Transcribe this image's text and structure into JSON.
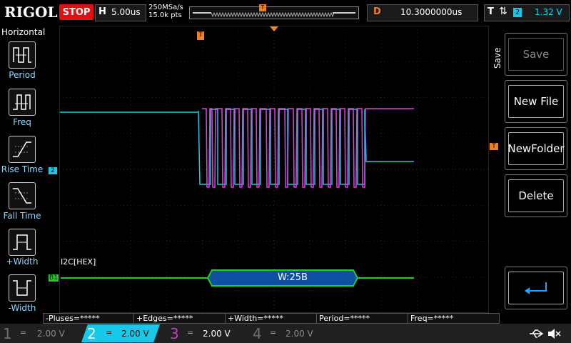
{
  "top_bar": {
    "logo": "RIGOL",
    "run_state": "STOP",
    "horizontal": {
      "label": "H",
      "value": "5.00us"
    },
    "sample_rate": "250MSa/s",
    "points": "15.0k pts",
    "trigger_position_marker": "T",
    "delay": {
      "label": "D",
      "value": "10.3000000us"
    },
    "trigger": {
      "label": "T",
      "edge": "⇅",
      "source": "2",
      "level": "1.32 V"
    }
  },
  "left_menu": {
    "title": "Horizontal",
    "items": [
      {
        "label": "Period",
        "icon": "period-icon"
      },
      {
        "label": "Freq",
        "icon": "frequency-icon"
      },
      {
        "label": "Rise Time",
        "icon": "rise-time-icon"
      },
      {
        "label": "Fall Time",
        "icon": "fall-time-icon"
      },
      {
        "label": "+Width",
        "icon": "positive-width-icon"
      },
      {
        "label": "-Width",
        "icon": "negative-width-icon"
      }
    ]
  },
  "right_menu": {
    "tab": "Save",
    "items": [
      {
        "label": "Save",
        "enabled": false
      },
      {
        "label": "New File",
        "enabled": true
      },
      {
        "label": "NewFolder",
        "enabled": true
      },
      {
        "label": "Delete",
        "enabled": true
      },
      {
        "label": "",
        "icon": "enter-icon",
        "enabled": true
      }
    ]
  },
  "screen": {
    "ch2_marker": "2",
    "trigger_level_marker": "T",
    "decode_label": "I2C[HEX]",
    "bus_marker": "B1",
    "decode_packet": "W:25B",
    "trigger_top_marker": "T"
  },
  "measurements": [
    "-Pluses=*****",
    "+Edges=*****",
    "+Width=*****",
    "Period=*****",
    "Freq=*****"
  ],
  "channels": [
    {
      "num": "1",
      "coupling": "=",
      "scale": "2.00 V",
      "color": "#6e6e6e",
      "active": false
    },
    {
      "num": "2",
      "coupling": "=",
      "scale": "2.00 V",
      "color": "#18c8e8",
      "active": true
    },
    {
      "num": "3",
      "coupling": "=",
      "scale": "2.00 V",
      "color": "#c040c0",
      "active": false
    },
    {
      "num": "4",
      "coupling": "=",
      "scale": "2.00 V",
      "color": "#6e6e6e",
      "active": false
    }
  ],
  "status_icons": {
    "usb": "usb-icon",
    "speaker": "speaker-muted-icon"
  },
  "colors": {
    "ch2": "#18c8e8",
    "ch3": "#e040e0",
    "bus": "#20d020",
    "packet": "#1050a0",
    "trigger": "#f08020"
  }
}
